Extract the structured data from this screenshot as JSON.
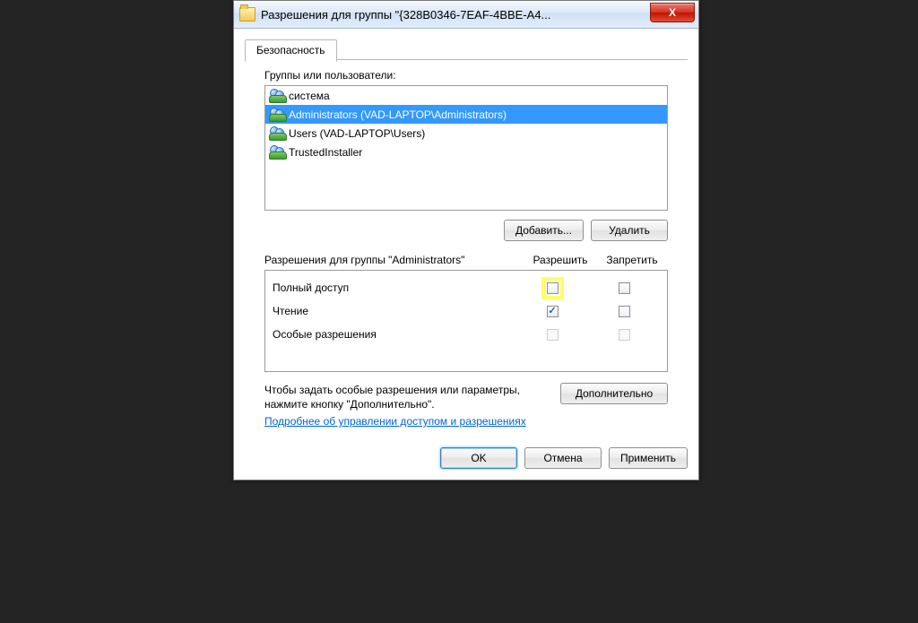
{
  "window": {
    "title": "Разрешения для группы \"{328B0346-7EAF-4BBE-A4..."
  },
  "tab": {
    "label": "Безопасность"
  },
  "groups": {
    "heading": "Группы или пользователи:",
    "items": [
      {
        "label": "система",
        "selected": false
      },
      {
        "label": "Administrators (VAD-LAPTOP\\Administrators)",
        "selected": true
      },
      {
        "label": "Users (VAD-LAPTOP\\Users)",
        "selected": false
      },
      {
        "label": "TrustedInstaller",
        "selected": false
      }
    ]
  },
  "buttons": {
    "add": "Добавить...",
    "remove": "Удалить",
    "advanced": "Дополнительно",
    "ok": "OK",
    "cancel": "Отмена",
    "apply": "Применить"
  },
  "perm": {
    "heading": "Разрешения для группы \"Administrators\"",
    "col_allow": "Разрешить",
    "col_deny": "Запретить",
    "rows": [
      {
        "name": "Полный доступ",
        "allow": false,
        "deny": false,
        "hl_allow": true,
        "pale": false
      },
      {
        "name": "Чтение",
        "allow": true,
        "deny": false,
        "hl_allow": false,
        "pale": false
      },
      {
        "name": "Особые разрешения",
        "allow": false,
        "deny": false,
        "hl_allow": false,
        "pale": true
      }
    ]
  },
  "advanced_text": "Чтобы задать особые разрешения или параметры, нажмите кнопку \"Дополнительно\".",
  "help_link": "Подробнее об управлении доступом и разрешениях "
}
